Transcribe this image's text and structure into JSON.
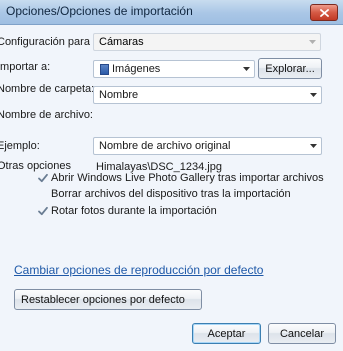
{
  "window": {
    "title": "Opciones/Opciones de importación"
  },
  "fields": {
    "config_label": "Configuración para :",
    "config_value": "Cámaras",
    "import_label": "Importar a:",
    "import_value": "Imágenes",
    "browse_button": "Explorar...",
    "folder_name_label": "Nombre de carpeta:",
    "folder_name_value": "Nombre",
    "file_name_label": "Nombre de archivo:",
    "file_name_value": "Nombre de archivo original",
    "example_label": "Ejemplo:",
    "example_value": "Himalayas\\DSC_1234.jpg"
  },
  "other_options": {
    "heading": "Otras opciones",
    "items": [
      {
        "label": "Abrir Windows Live Photo Gallery tras importar archivos",
        "checked": true
      },
      {
        "label": "Borrar archivos del dispositivo tras la importación",
        "checked": false
      },
      {
        "label": "Rotar fotos durante la importación",
        "checked": true
      }
    ]
  },
  "link": {
    "text": "Cambiar opciones de reproducción por defecto"
  },
  "buttons": {
    "restore": "Restablecer opciones por defecto",
    "accept": "Aceptar",
    "cancel": "Cancelar"
  },
  "colors": {
    "link": "#1f59a8",
    "title_bar": "#a9c6e6",
    "close_button": "#d55a45"
  },
  "icons": {
    "close": "close-icon",
    "folder": "folder-icon",
    "dropdown": "chevron-down-icon",
    "checkbox": "checkbox-check-icon"
  }
}
